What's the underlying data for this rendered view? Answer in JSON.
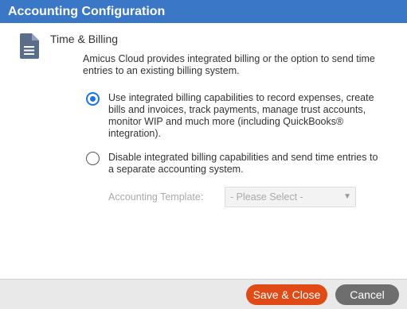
{
  "window": {
    "title": "Accounting Configuration"
  },
  "section": {
    "icon": "document-icon",
    "title": "Time & Billing",
    "intro": "Amicus Cloud provides integrated billing or the option to send time entries to an existing billing system."
  },
  "options": [
    {
      "text": "Use integrated billing capabilities to record expenses, create bills and invoices, track payments, manage trust accounts, monitor WIP and much more (including QuickBooks® integration).",
      "selected": true
    },
    {
      "text": "Disable integrated billing capabilities and send time entries to a separate accounting system.",
      "selected": false
    }
  ],
  "template": {
    "label": "Accounting Template:",
    "selected_value": "- Please Select -",
    "disabled": true
  },
  "footer": {
    "save_label": "Save & Close",
    "cancel_label": "Cancel"
  },
  "colors": {
    "titlebar": "#3a78c7",
    "icon": "#5a6e8c",
    "radio_selected": "#1a73e8",
    "save_button": "#e04a16",
    "cancel_button": "#6e6e6e",
    "footer": "#e9e9e9"
  }
}
